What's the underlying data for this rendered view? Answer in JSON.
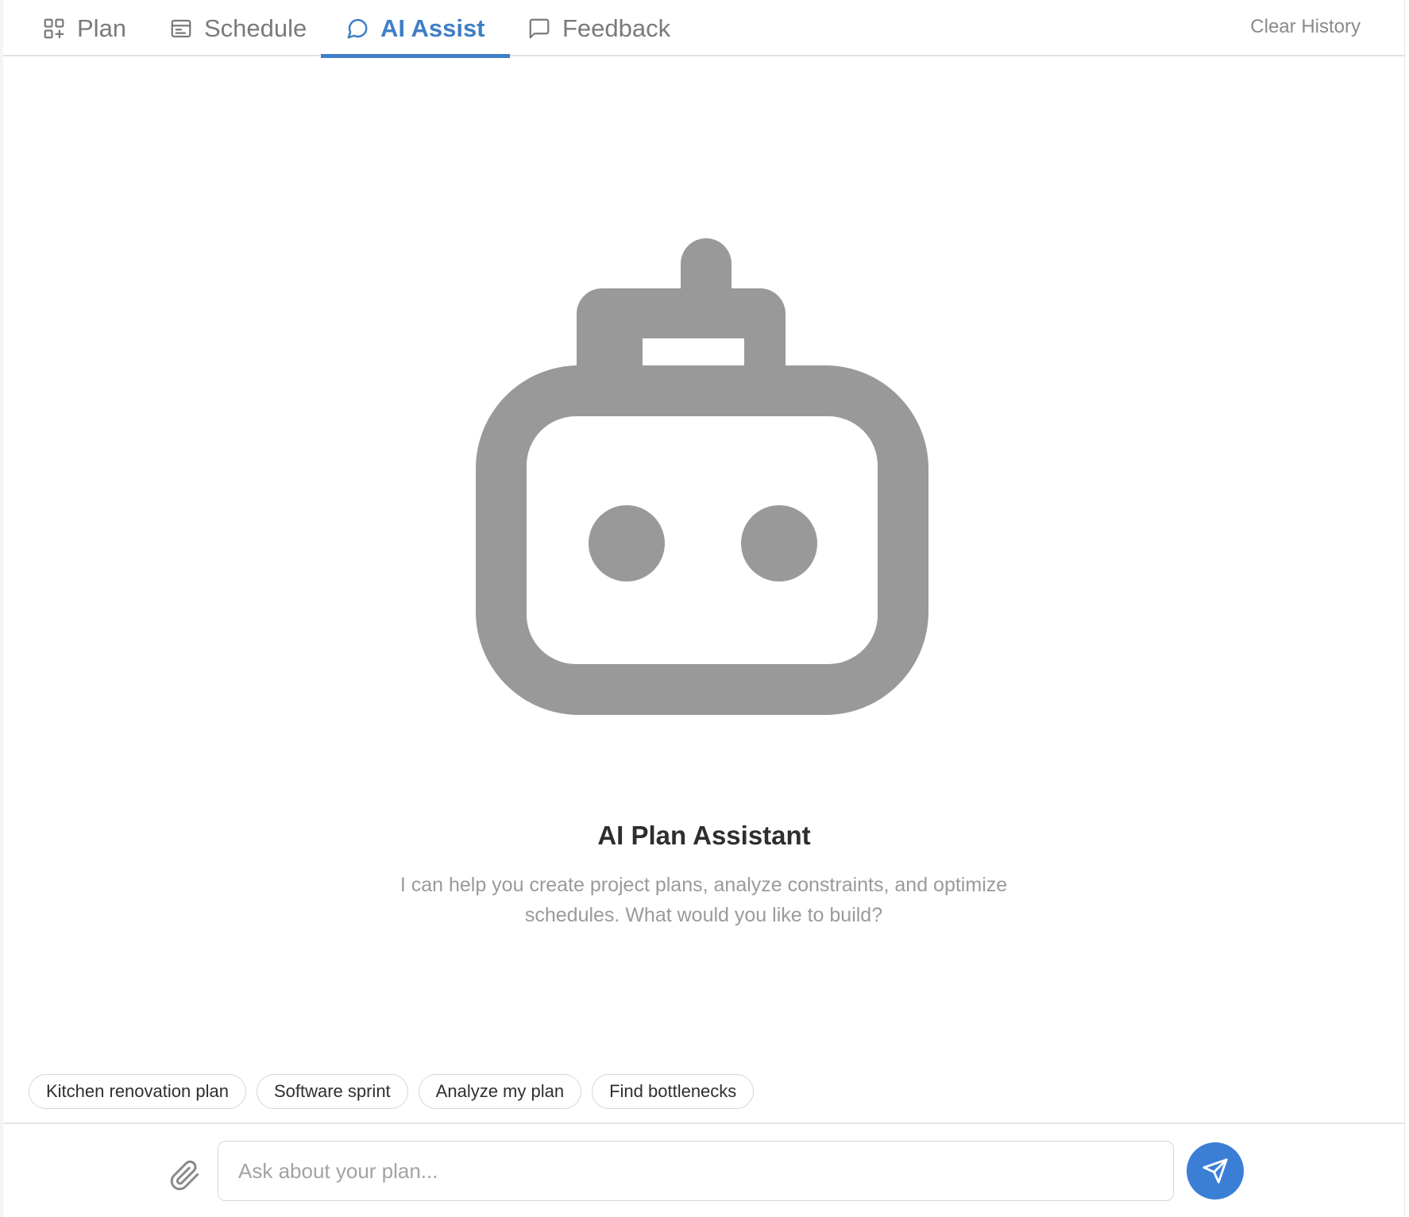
{
  "tabs": [
    {
      "label": "Plan",
      "icon": "grid-plus-icon",
      "active": false
    },
    {
      "label": "Schedule",
      "icon": "calendar-table-icon",
      "active": false
    },
    {
      "label": "AI Assist",
      "icon": "chat-bubble-icon",
      "active": true
    },
    {
      "label": "Feedback",
      "icon": "message-square-icon",
      "active": false
    }
  ],
  "header": {
    "clear_history_label": "Clear History"
  },
  "hero": {
    "icon": "robot-icon",
    "title": "AI Plan Assistant",
    "subtitle": "I can help you create project plans, analyze constraints, and optimize schedules. What would you like to build?"
  },
  "suggestions": [
    "Kitchen renovation plan",
    "Software sprint",
    "Analyze my plan",
    "Find bottlenecks"
  ],
  "composer": {
    "placeholder": "Ask about your plan...",
    "value": "",
    "attach_icon": "paperclip-icon",
    "send_icon": "send-icon"
  },
  "colors": {
    "accent": "#3f7ec6",
    "send_button": "#3b7ed6",
    "robot": "#999999",
    "muted_text": "#9a9a9a"
  }
}
